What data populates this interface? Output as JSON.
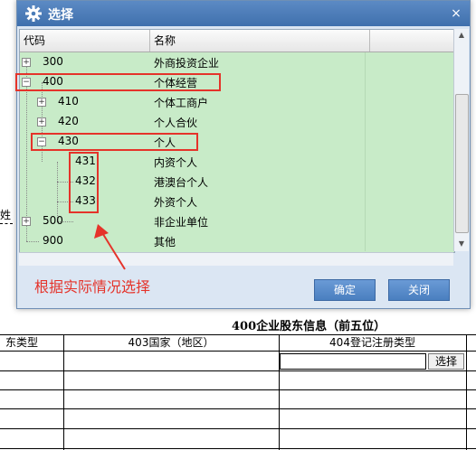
{
  "dialog": {
    "title": "选择",
    "columns": {
      "code": "代码",
      "name": "名称"
    },
    "rows": [
      {
        "code": "300",
        "name": "外商投资企业",
        "expander": "+"
      },
      {
        "code": "400",
        "name": "个体经营",
        "expander": "−"
      },
      {
        "code": "410",
        "name": "个体工商户",
        "expander": "+"
      },
      {
        "code": "420",
        "name": "个人合伙",
        "expander": "+"
      },
      {
        "code": "430",
        "name": "个人",
        "expander": "−"
      },
      {
        "code": "431",
        "name": "内资个人",
        "expander": ""
      },
      {
        "code": "432",
        "name": "港澳台个人",
        "expander": ""
      },
      {
        "code": "433",
        "name": "外资个人",
        "expander": ""
      },
      {
        "code": "500",
        "name": "非企业单位",
        "expander": "+"
      },
      {
        "code": "900",
        "name": "其他",
        "expander": ""
      }
    ],
    "ok_label": "确定",
    "close_label": "关闭",
    "close_icon": "×"
  },
  "annotation": "根据实际情况选择",
  "background": {
    "left_fragment": "姓",
    "section_title": "400企业股东信息（前五位）",
    "col_headers": [
      "东类型",
      "403国家（地区）",
      "404登记注册类型"
    ],
    "select_button": "选择"
  },
  "colors": {
    "grid_bg": "#c8ebc8",
    "highlight": "#e5332a",
    "button": "#4a7fc0",
    "titlebar": "#4a7cb8"
  }
}
